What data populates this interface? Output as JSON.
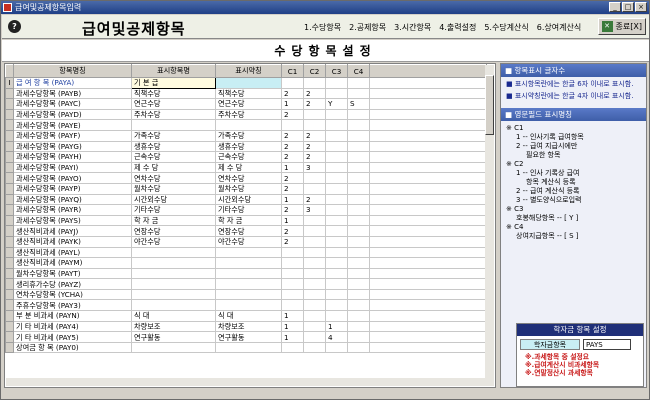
{
  "window": {
    "title": "급여및공제항목입력"
  },
  "header": {
    "title": "급여및공제항목",
    "icon_text": "?",
    "menu": [
      "1.수당항목",
      "2.공제항목",
      "3.시간항목",
      "4.출력설정",
      "5.수당계산식",
      "6.상여계산식"
    ],
    "exit_label": "종료[X]"
  },
  "subtitle": "수당항목설정",
  "table": {
    "columns": [
      "항목명칭",
      "표시항목명",
      "표시약칭",
      "C1",
      "C2",
      "C3",
      "C4"
    ],
    "rows": [
      [
        "급 여 항 목 (PAYA)",
        "기 본 급",
        "",
        "",
        "",
        "",
        ""
      ],
      [
        "과세수당항목 (PAYB)",
        "직책수당",
        "직책수당",
        "2",
        "2",
        "",
        ""
      ],
      [
        "과세수당항목 (PAYC)",
        "연근수당",
        "연근수당",
        "1",
        "2",
        "Y",
        "S"
      ],
      [
        "과세수당항목 (PAYD)",
        "주차수당",
        "주차수당",
        "2",
        "",
        "",
        ""
      ],
      [
        "과세수당항목 (PAYE)",
        "",
        "",
        "",
        "",
        "",
        ""
      ],
      [
        "과세수당항목 (PAYF)",
        "가족수당",
        "가족수당",
        "2",
        "2",
        "",
        ""
      ],
      [
        "과세수당항목 (PAYG)",
        "생휴수당",
        "생휴수당",
        "2",
        "2",
        "",
        ""
      ],
      [
        "과세수당항목 (PAYH)",
        "근속수당",
        "근속수당",
        "2",
        "2",
        "",
        ""
      ],
      [
        "과세수당항목 (PAYI)",
        "제 수 당",
        "제 수 당",
        "1",
        "3",
        "",
        ""
      ],
      [
        "과세수당항목 (PAYO)",
        "연차수당",
        "연차수당",
        "2",
        "",
        "",
        ""
      ],
      [
        "과세수당항목 (PAYP)",
        "월차수당",
        "월차수당",
        "2",
        "",
        "",
        ""
      ],
      [
        "과세수당항목 (PAYQ)",
        "시간외수당",
        "시간외수당",
        "1",
        "2",
        "",
        ""
      ],
      [
        "과세수당항목 (PAYR)",
        "기타수당",
        "기타수당",
        "2",
        "3",
        "",
        ""
      ],
      [
        "과세수당항목 (PAYS)",
        "학 자 금",
        "학 자 금",
        "1",
        "",
        "",
        ""
      ],
      [
        "생산직비과세 (PAYJ)",
        "연장수당",
        "연장수당",
        "2",
        "",
        "",
        ""
      ],
      [
        "생산직비과세 (PAYK)",
        "야간수당",
        "야간수당",
        "2",
        "",
        "",
        ""
      ],
      [
        "생산직비과세 (PAYL)",
        "",
        "",
        "",
        "",
        "",
        ""
      ],
      [
        "생산직비과세 (PAYM)",
        "",
        "",
        "",
        "",
        "",
        ""
      ],
      [
        "월차수당항목 (PAYT)",
        "",
        "",
        "",
        "",
        "",
        ""
      ],
      [
        "생리휴가수당 (PAYZ)",
        "",
        "",
        "",
        "",
        "",
        ""
      ],
      [
        "연차수당항목 (YCHA)",
        "",
        "",
        "",
        "",
        "",
        ""
      ],
      [
        "주휴수당항목 (PAY3)",
        "",
        "",
        "",
        "",
        "",
        ""
      ],
      [
        "부 분 비과세 (PAYN)",
        "식 대",
        "식 대",
        "1",
        "",
        "",
        ""
      ],
      [
        "기 타 비과세 (PAY4)",
        "차량보조",
        "차량보조",
        "1",
        "",
        "1",
        ""
      ],
      [
        "기 타 비과세 (PAY5)",
        "연구활동",
        "연구활동",
        "1",
        "",
        "4",
        ""
      ],
      [
        "상여금 항 목 (PAY0)",
        "",
        "",
        "",
        "",
        "",
        ""
      ]
    ]
  },
  "panel1": {
    "title": "항목표시 글자수",
    "lines": [
      "표시항목란에는 한글 6자 이내로 표시함.",
      "표시약칭란에는 한글 4자 이내로 표시함."
    ]
  },
  "panel2": {
    "title": "영문필드 표시명칭",
    "lines": [
      {
        "t": "※ C1",
        "c": ""
      },
      {
        "t": "1 -- 인사기록 급여항목",
        "c": "ind1"
      },
      {
        "t": "2 -- 급여 지급시에만",
        "c": "ind1"
      },
      {
        "t": "필요한 항목",
        "c": "ind2"
      },
      {
        "t": "※ C2",
        "c": ""
      },
      {
        "t": "1 -- 인사 기록상 급여",
        "c": "ind1"
      },
      {
        "t": "항목 계산식 등록",
        "c": "ind2"
      },
      {
        "t": "2 -- 급여 계산식 등록",
        "c": "ind1"
      },
      {
        "t": "3 -- 별도양식으로입력",
        "c": "ind1"
      },
      {
        "t": "※ C3",
        "c": ""
      },
      {
        "t": "호봉해당항목 -- [ Y ]",
        "c": "ind1"
      },
      {
        "t": "※ C4",
        "c": ""
      },
      {
        "t": "상여지급항목 -- [ S ]",
        "c": "ind1"
      }
    ]
  },
  "hak": {
    "title": "학자금 항목 설정",
    "label": "학자금항목",
    "value": "PAYS",
    "notes": [
      "※.과세항목 중 설정요",
      "※.급여계산시 비과세항목",
      "※.연말정산시 과세항목"
    ]
  }
}
